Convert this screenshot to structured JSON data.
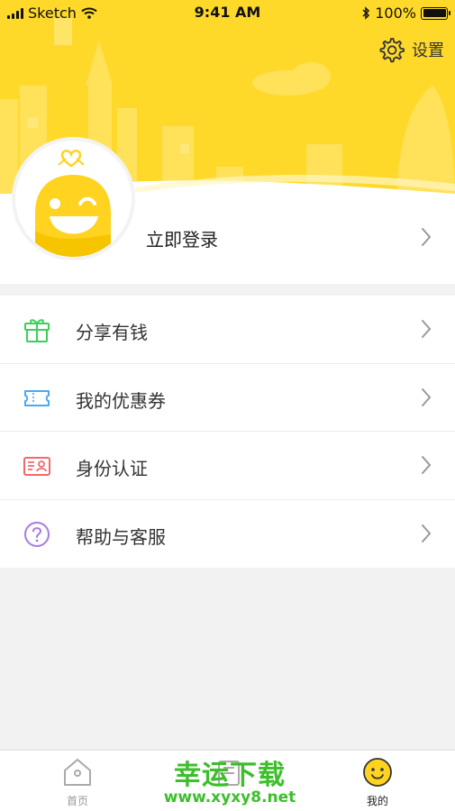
{
  "status_bar": {
    "carrier": "Sketch",
    "time": "9:41 AM",
    "battery": "100%"
  },
  "header": {
    "settings_label": "设置",
    "login_label": "立即登录"
  },
  "menu": {
    "items": [
      {
        "label": "分享有钱",
        "icon": "gift-icon",
        "color": "#3ccf5a"
      },
      {
        "label": "我的优惠券",
        "icon": "ticket-icon",
        "color": "#4aa9f0"
      },
      {
        "label": "身份认证",
        "icon": "id-card-icon",
        "color": "#f06a6a"
      },
      {
        "label": "帮助与客服",
        "icon": "help-icon",
        "color": "#a77be0"
      }
    ]
  },
  "tabbar": {
    "tabs": [
      {
        "label": "首页",
        "icon": "home-icon",
        "active": false
      },
      {
        "label": "",
        "icon": "orders-icon",
        "active": false
      },
      {
        "label": "我的",
        "icon": "smiley-icon",
        "active": true
      }
    ]
  },
  "watermark": {
    "title": "幸运下载",
    "url": "www.xyxy8.net"
  },
  "colors": {
    "brand_yellow": "#ffd92a",
    "background": "#f2f2f2",
    "watermark_green": "#3cbf2a"
  }
}
